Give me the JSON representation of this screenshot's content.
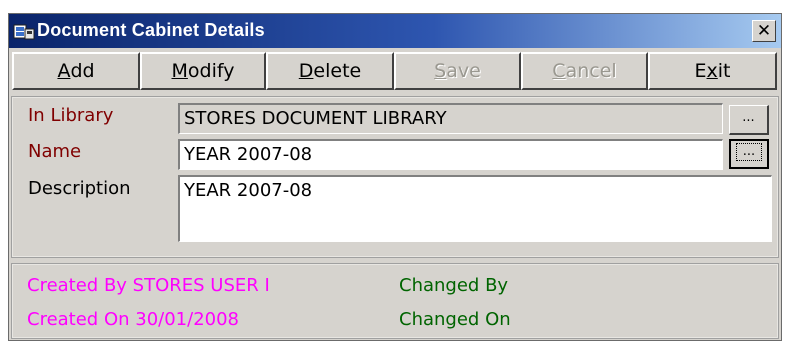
{
  "window": {
    "title": "Document Cabinet Details",
    "close_glyph": "✕"
  },
  "toolbar": {
    "buttons": [
      {
        "pre": "",
        "mnemonic": "A",
        "post": "dd",
        "enabled": true
      },
      {
        "pre": "",
        "mnemonic": "M",
        "post": "odify",
        "enabled": true
      },
      {
        "pre": "",
        "mnemonic": "D",
        "post": "elete",
        "enabled": true
      },
      {
        "pre": "",
        "mnemonic": "S",
        "post": "ave",
        "enabled": false
      },
      {
        "pre": "",
        "mnemonic": "C",
        "post": "ancel",
        "enabled": false
      },
      {
        "pre": "E",
        "mnemonic": "x",
        "post": "it",
        "enabled": true
      }
    ]
  },
  "form": {
    "library_label": "In Library",
    "library_value": "STORES DOCUMENT LIBRARY",
    "name_label": "Name",
    "name_value": "YEAR 2007-08",
    "description_label": "Description",
    "description_value": "YEAR 2007-08",
    "browse_label": "..."
  },
  "status": {
    "created_by": "Created By STORES USER I",
    "created_on": "Created On 30/01/2008",
    "changed_by": "Changed By",
    "changed_on": "Changed On"
  },
  "colors": {
    "required_label": "#800000",
    "created_text": "#ff00ff",
    "changed_text": "#006400",
    "title_start": "#0a246a",
    "title_end": "#a6caf0"
  }
}
